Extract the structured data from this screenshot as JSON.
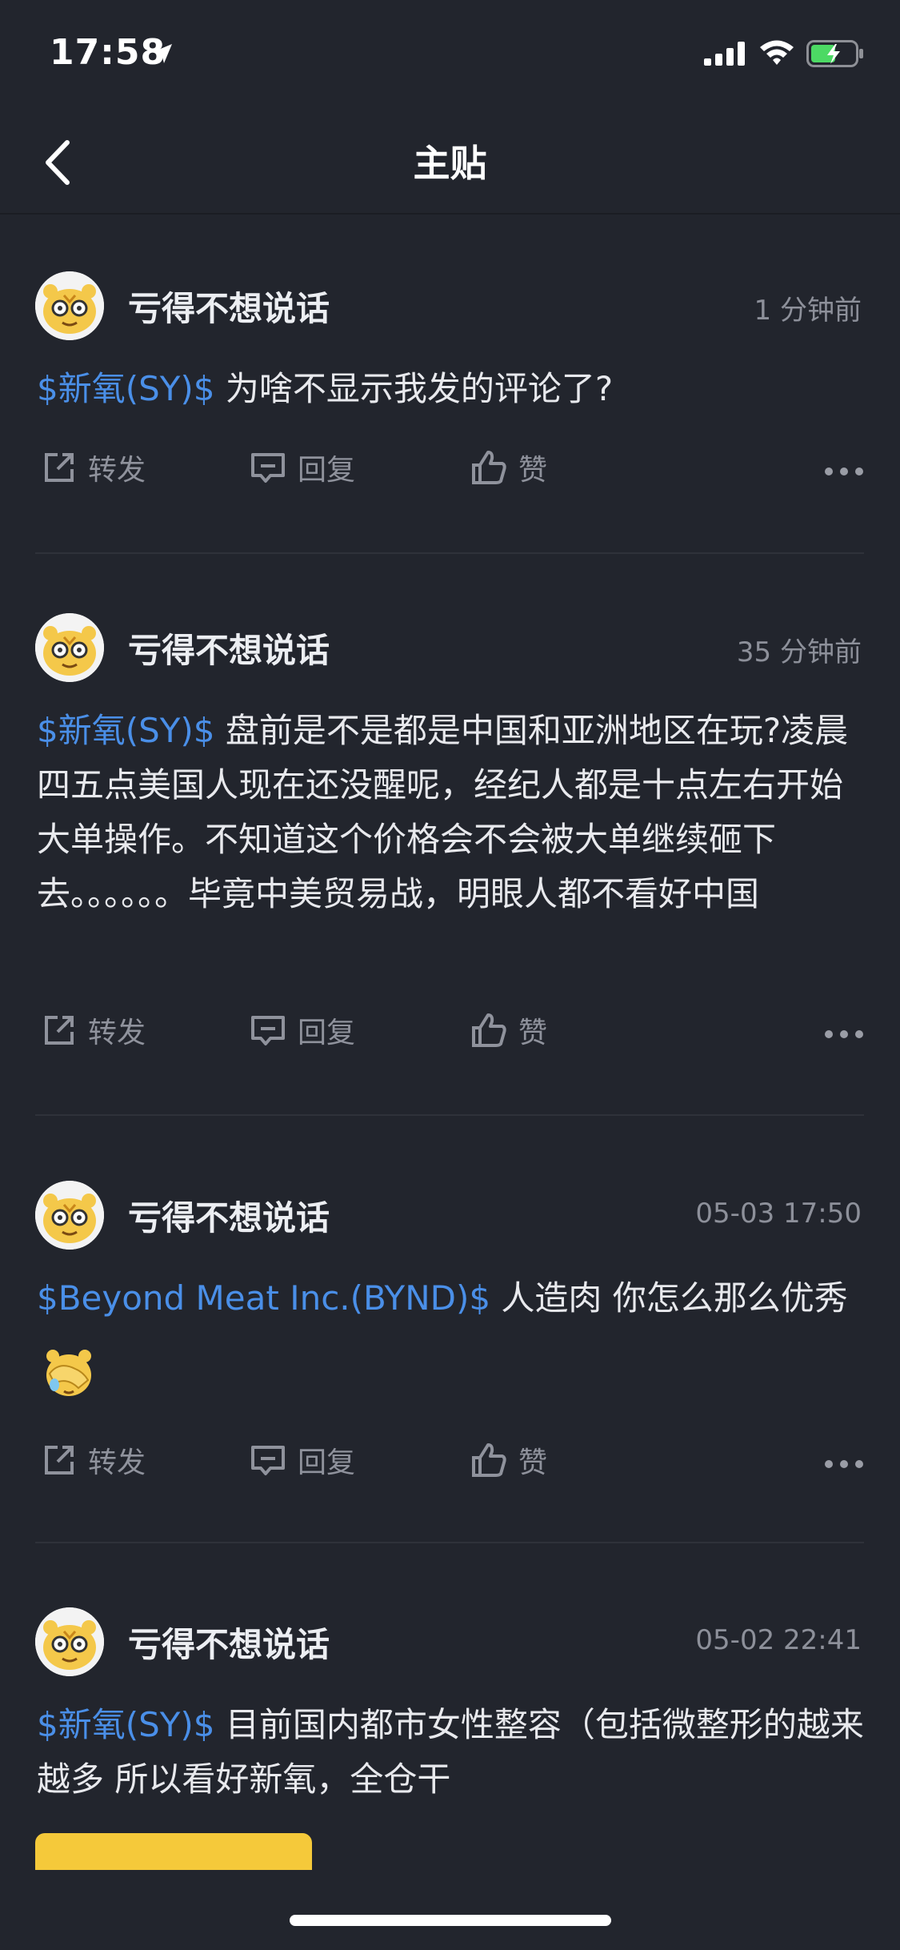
{
  "status_bar": {
    "time": "17:58"
  },
  "nav": {
    "title": "主贴"
  },
  "actions": {
    "share": "转发",
    "reply": "回复",
    "like": "赞"
  },
  "posts": [
    {
      "username": "亏得不想说话",
      "time": "1 分钟前",
      "tag": "$新氧(SY)$",
      "text": " 为啥不显示我发的评论了?"
    },
    {
      "username": "亏得不想说话",
      "time": "35 分钟前",
      "tag": "$新氧(SY)$",
      "text": " 盘前是不是都是中国和亚洲地区在玩?凌晨四五点美国人现在还没醒呢，经纪人都是十点左右开始大单操作。不知道这个价格会不会被大单继续砸下去。。。。。。毕竟中美贸易战，明眼人都不看好中国"
    },
    {
      "username": "亏得不想说话",
      "time": "05-03 17:50",
      "tag": "$Beyond Meat Inc.(BYND)$",
      "text": " 人造肉 你怎么那么优秀"
    },
    {
      "username": "亏得不想说话",
      "time": "05-02 22:41",
      "tag": "$新氧(SY)$",
      "text": " 目前国内都市女性整容（包括微整形的越来越多 所以看好新氧，全仓干"
    }
  ]
}
